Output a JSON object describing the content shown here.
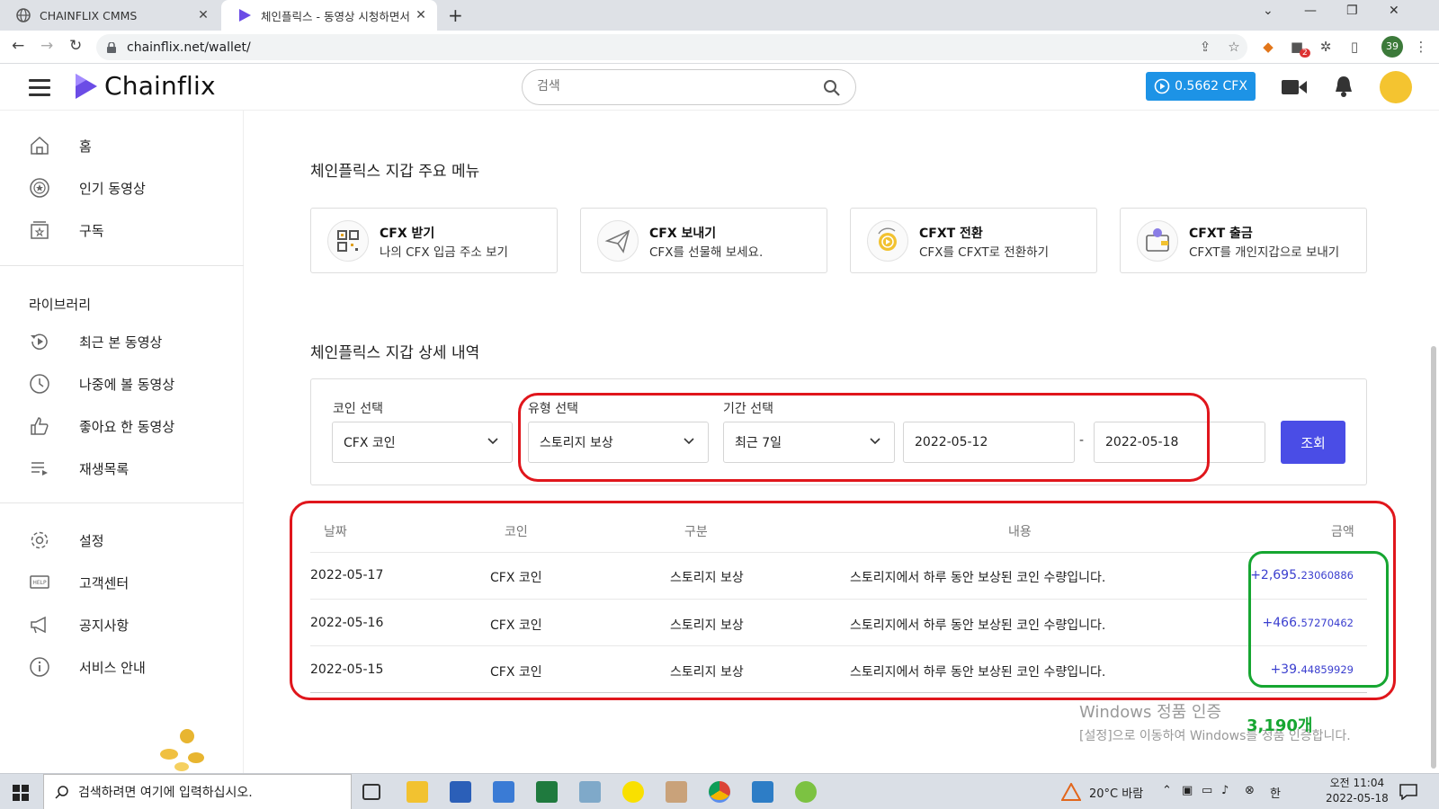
{
  "browser": {
    "tabs": [
      {
        "title": "CHAINFLIX CMMS",
        "active": false
      },
      {
        "title": "체인플릭스 - 동영상 시청하면서",
        "active": true
      }
    ],
    "url": "chainflix.net/wallet/",
    "profile_badge": "39",
    "extension_badge": "2"
  },
  "header": {
    "logo_text": "Chainflix",
    "search_placeholder": "검색",
    "balance_label": "0.5662 CFX"
  },
  "sidebar": {
    "main_items": [
      {
        "label": "홈",
        "icon": "home-icon"
      },
      {
        "label": "인기 동영상",
        "icon": "popular-icon"
      },
      {
        "label": "구독",
        "icon": "subscribe-icon"
      }
    ],
    "library_title": "라이브러리",
    "library_items": [
      {
        "label": "최근 본 동영상",
        "icon": "history-icon"
      },
      {
        "label": "나중에 볼 동영상",
        "icon": "clock-icon"
      },
      {
        "label": "좋아요 한 동영상",
        "icon": "thumbs-up-icon"
      },
      {
        "label": "재생목록",
        "icon": "playlist-icon"
      }
    ],
    "footer_items": [
      {
        "label": "설정",
        "icon": "gear-icon"
      },
      {
        "label": "고객센터",
        "icon": "help-icon"
      },
      {
        "label": "공지사항",
        "icon": "megaphone-icon"
      },
      {
        "label": "서비스 안내",
        "icon": "info-icon"
      }
    ]
  },
  "wallet": {
    "menu_title": "체인플릭스 지갑 주요 메뉴",
    "cards": [
      {
        "title": "CFX 받기",
        "subtitle": "나의 CFX 입금 주소 보기",
        "icon": "qr-code-icon"
      },
      {
        "title": "CFX 보내기",
        "subtitle": "CFX를 선물해 보세요.",
        "icon": "paper-plane-icon"
      },
      {
        "title": "CFXT 전환",
        "subtitle": "CFX를 CFXT로 전환하기",
        "icon": "convert-coin-icon"
      },
      {
        "title": "CFXT 출금",
        "subtitle": "CFXT를 개인지갑으로 보내기",
        "icon": "wallet-withdraw-icon"
      }
    ],
    "detail_title": "체인플릭스 지갑 상세 내역",
    "filters": {
      "coin_label": "코인 선택",
      "coin_value": "CFX 코인",
      "type_label": "유형 선택",
      "type_value": "스토리지 보상",
      "period_label": "기간 선택",
      "period_value": "최근 7일",
      "start_date": "2022-05-12",
      "date_separator": "-",
      "end_date": "2022-05-18",
      "submit_label": "조회"
    },
    "table": {
      "headers": [
        "날짜",
        "코인",
        "구분",
        "내용",
        "금액"
      ],
      "rows": [
        {
          "date": "2022-05-17",
          "coin": "CFX 코인",
          "type": "스토리지 보상",
          "desc": "스토리지에서 하루 동안 보상된 코인 수량입니다.",
          "amount_main": "+2,695.",
          "amount_frac": "23060886"
        },
        {
          "date": "2022-05-16",
          "coin": "CFX 코인",
          "type": "스토리지 보상",
          "desc": "스토리지에서 하루 동안 보상된 코인 수량입니다.",
          "amount_main": "+466.",
          "amount_frac": "57270462"
        },
        {
          "date": "2022-05-15",
          "coin": "CFX 코인",
          "type": "스토리지 보상",
          "desc": "스토리지에서 하루 동안 보상된 코인 수량입니다.",
          "amount_main": "+39.",
          "amount_frac": "44859929"
        }
      ]
    },
    "annotation_count": "3,190개"
  },
  "windows_watermark": {
    "line1": "Windows 정품 인증",
    "line2": "[설정]으로 이동하여 Windows를 정품 인증합니다."
  },
  "taskbar": {
    "search_placeholder": "검색하려면 여기에 입력하십시오.",
    "weather": "20°C 바람",
    "ime": "한",
    "time": "오전 11:04",
    "date": "2022-05-18"
  },
  "colors": {
    "brand_purple": "#6b4ce6",
    "balance_blue": "#1d93e6",
    "submit_blue": "#4a4de6",
    "annotation_red": "#e0161c",
    "annotation_green": "#16a631",
    "amount_text": "#3b3fcf"
  }
}
